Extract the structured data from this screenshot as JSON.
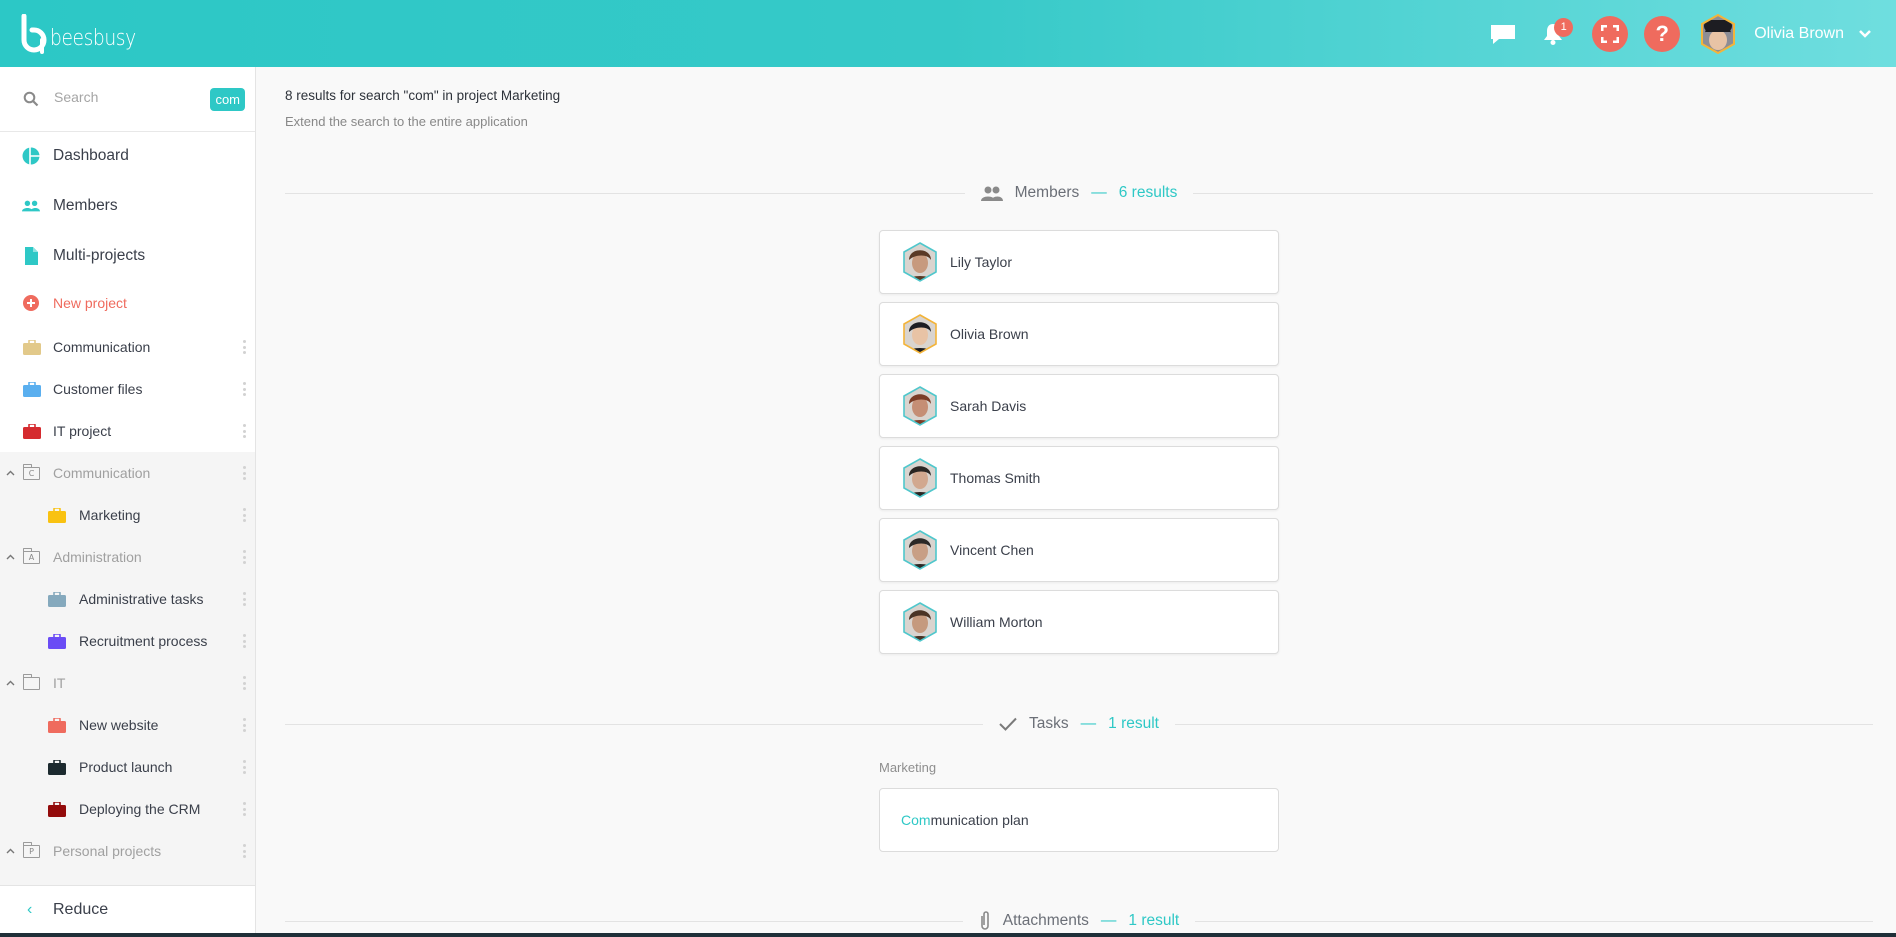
{
  "header": {
    "app_name": "beesbusy",
    "notifications_count": "1",
    "user_name": "Olivia Brown",
    "icons": [
      "chat-icon",
      "bell-icon",
      "fullscreen-icon",
      "help-icon",
      "user-avatar",
      "chevron-down-icon"
    ],
    "help_label": "?"
  },
  "sidebar": {
    "search": {
      "placeholder": "Search",
      "value": "",
      "chip": "com"
    },
    "nav": [
      {
        "label": "Dashboard",
        "icon": "dashboard-icon"
      },
      {
        "label": "Members",
        "icon": "members-icon"
      },
      {
        "label": "Multi-projects",
        "icon": "document-icon"
      }
    ],
    "new_project": {
      "label": "New project",
      "icon": "plus-circle-icon"
    },
    "projects": [
      {
        "label": "Communication",
        "color": "#e2c98a"
      },
      {
        "label": "Customer files",
        "color": "#5aafef"
      },
      {
        "label": "IT project",
        "color": "#d52b2f"
      }
    ],
    "folders": [
      {
        "label": "Communication",
        "letter": "C",
        "expanded": true,
        "projects": [
          {
            "label": "Marketing",
            "color": "#f9c211"
          }
        ]
      },
      {
        "label": "Administration",
        "letter": "A",
        "expanded": true,
        "projects": [
          {
            "label": "Administrative tasks",
            "color": "#85a9bd"
          },
          {
            "label": "Recruitment process",
            "color": "#6a4cf5"
          }
        ]
      },
      {
        "label": "IT",
        "letter": "",
        "expanded": true,
        "projects": [
          {
            "label": "New website",
            "color": "#ef6b5e"
          },
          {
            "label": "Product launch",
            "color": "#1c2a2f"
          },
          {
            "label": "Deploying the CRM",
            "color": "#930b0b"
          }
        ]
      },
      {
        "label": "Personal projects",
        "letter": "P",
        "expanded": true,
        "projects": []
      }
    ],
    "reduce_label": "Reduce"
  },
  "main": {
    "summary": "8 results for search \"com\" in project Marketing",
    "extend_link": "Extend the search to the entire application",
    "sections": {
      "members": {
        "title": "Members",
        "dash": "—",
        "count": "6 results",
        "icon": "members-icon"
      },
      "tasks": {
        "title": "Tasks",
        "dash": "—",
        "count": "1 result",
        "icon": "check-icon"
      },
      "attachments": {
        "title": "Attachments",
        "dash": "—",
        "count": "1 result",
        "icon": "paperclip-icon"
      }
    },
    "members": [
      {
        "name": "Lily Taylor",
        "border": "#4fc7cc",
        "skin": "#c79a7e",
        "hair": "#5a3a26"
      },
      {
        "name": "Olivia Brown",
        "border": "#f3b43a",
        "skin": "#e8c3a5",
        "hair": "#1d1d22"
      },
      {
        "name": "Sarah Davis",
        "border": "#4fc7cc",
        "skin": "#c58e75",
        "hair": "#7b3c26"
      },
      {
        "name": "Thomas Smith",
        "border": "#4fc7cc",
        "skin": "#d2a88f",
        "hair": "#2a2522"
      },
      {
        "name": "Vincent Chen",
        "border": "#4fc7cc",
        "skin": "#c89f85",
        "hair": "#2b2927"
      },
      {
        "name": "William Morton",
        "border": "#4fc7cc",
        "skin": "#c59a7e",
        "hair": "#4a3425"
      }
    ],
    "tasks": {
      "group": "Marketing",
      "items": [
        {
          "match": "Com",
          "rest": "munication plan"
        }
      ]
    }
  },
  "colors": {
    "accent": "#2ec8c6",
    "danger": "#ef6b5e"
  }
}
